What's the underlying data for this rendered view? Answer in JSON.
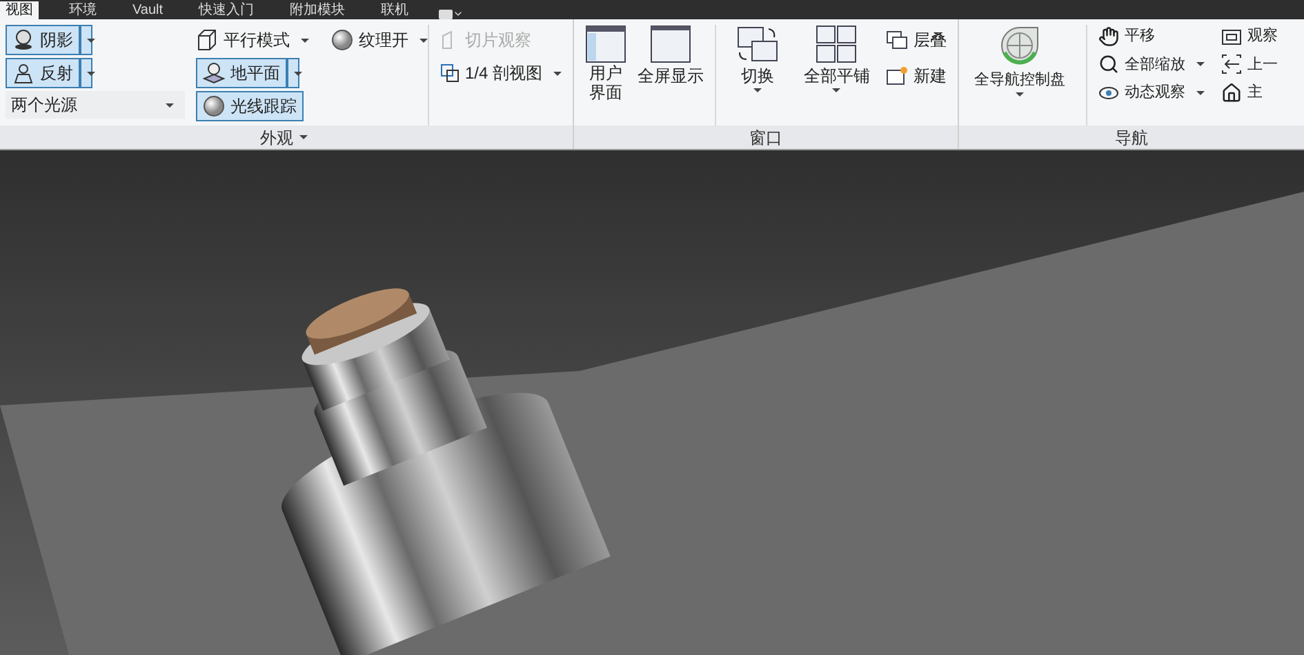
{
  "tabs": [
    {
      "label": "视图",
      "selected": true
    },
    {
      "label": "环境",
      "selected": false
    },
    {
      "label": "Vault",
      "selected": false
    },
    {
      "label": "快速入门",
      "selected": false
    },
    {
      "label": "附加模块",
      "selected": false
    },
    {
      "label": "联机",
      "selected": false
    }
  ],
  "appearance": {
    "title": "外观",
    "shadow": {
      "label": "阴影",
      "on": true
    },
    "reflection": {
      "label": "反射",
      "on": true
    },
    "lighting": {
      "value": "两个光源"
    },
    "projection": {
      "label": "平行模式"
    },
    "texture": {
      "label": "纹理开"
    },
    "ground": {
      "label": "地平面",
      "on": true
    },
    "raytrace": {
      "label": "光线跟踪",
      "on": true
    },
    "slice": {
      "label": "切片观察",
      "disabled": true
    },
    "quarter": {
      "label": "1/4 剖视图",
      "disabled": false
    }
  },
  "window_panel": {
    "title": "窗口",
    "user_interface": "用户界面",
    "fullscreen": "全屏显示",
    "switch": "切换",
    "tile": "全部平铺",
    "cascade": "层叠",
    "new": "新建"
  },
  "navigation": {
    "title": "导航",
    "wheel": "全导航控制盘",
    "pan": "平移",
    "zoom_all": "全部缩放",
    "orbit": "动态观察",
    "look": "观察",
    "previous": "上一",
    "home": "主"
  }
}
